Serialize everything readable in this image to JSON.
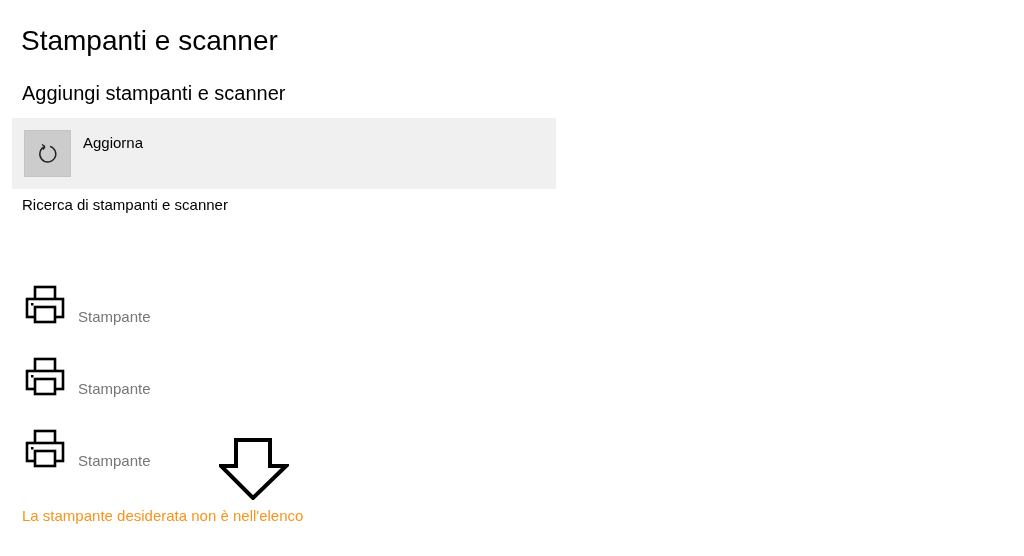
{
  "page_title": "Stampanti e scanner",
  "section_title": "Aggiungi stampanti e scanner",
  "refresh": {
    "label": "Aggiorna"
  },
  "status": "Ricerca di stampanti e scanner",
  "printers": [
    {
      "type": "Stampante"
    },
    {
      "type": "Stampante"
    },
    {
      "type": "Stampante"
    }
  ],
  "missing_link": "La stampante desiderata non è nell'elenco"
}
